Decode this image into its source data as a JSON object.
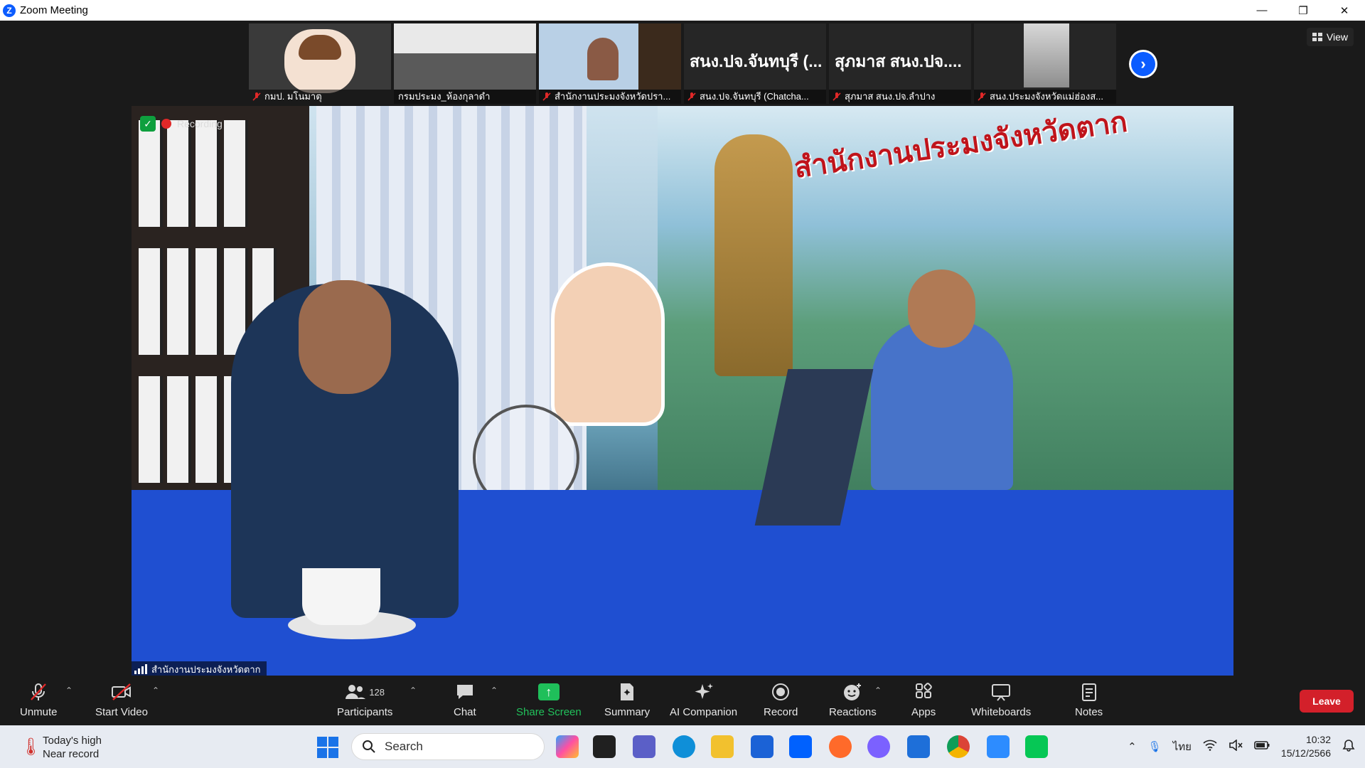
{
  "window": {
    "title": "Zoom Meeting",
    "controls": {
      "minimize": "—",
      "restore": "❐",
      "close": "✕"
    }
  },
  "gallery": {
    "thumbnails": [
      {
        "name": "กมป. มโนมาตุ",
        "kind": "cartoon"
      },
      {
        "name": "กรมประมง_ห้องกุลาดำ",
        "kind": "room"
      },
      {
        "name": "สำนักงานประมงจังหวัดปรา...",
        "kind": "woman"
      },
      {
        "name": "สนง.ปจ.จันทบุรี (Chatcha...",
        "kind": "text",
        "display": "สนง.ปจ.จันทบุรี (..."
      },
      {
        "name": "สุภมาส สนง.ปจ.ลำปาง",
        "kind": "text",
        "display": "สุภมาส สนง.ปจ...."
      },
      {
        "name": "สนง.ประมงจังหวัดแม่ฮ่องส...",
        "kind": "door"
      }
    ],
    "next_icon": "›",
    "view_label": "View"
  },
  "main_video": {
    "recording_text": "Recording",
    "banner_text": "สำนักงานประมงจังหวัดตาก",
    "speaker_name": "สำนักงานประมงจังหวัดตาก"
  },
  "toolbar": {
    "unmute": "Unmute",
    "start_video": "Start Video",
    "participants": "Participants",
    "participants_count": "128",
    "chat": "Chat",
    "share_screen": "Share Screen",
    "summary": "Summary",
    "ai_companion": "AI Companion",
    "record": "Record",
    "reactions": "Reactions",
    "apps": "Apps",
    "whiteboards": "Whiteboards",
    "notes": "Notes",
    "leave": "Leave"
  },
  "taskbar": {
    "weather_line1": "Today's high",
    "weather_line2": "Near record",
    "search_placeholder": "Search",
    "language": "ไทย",
    "time": "10:32",
    "date": "15/12/2566"
  },
  "colors": {
    "zoom_blue": "#0b5cff",
    "leave_red": "#d3202a",
    "share_green": "#1fbf5a"
  }
}
